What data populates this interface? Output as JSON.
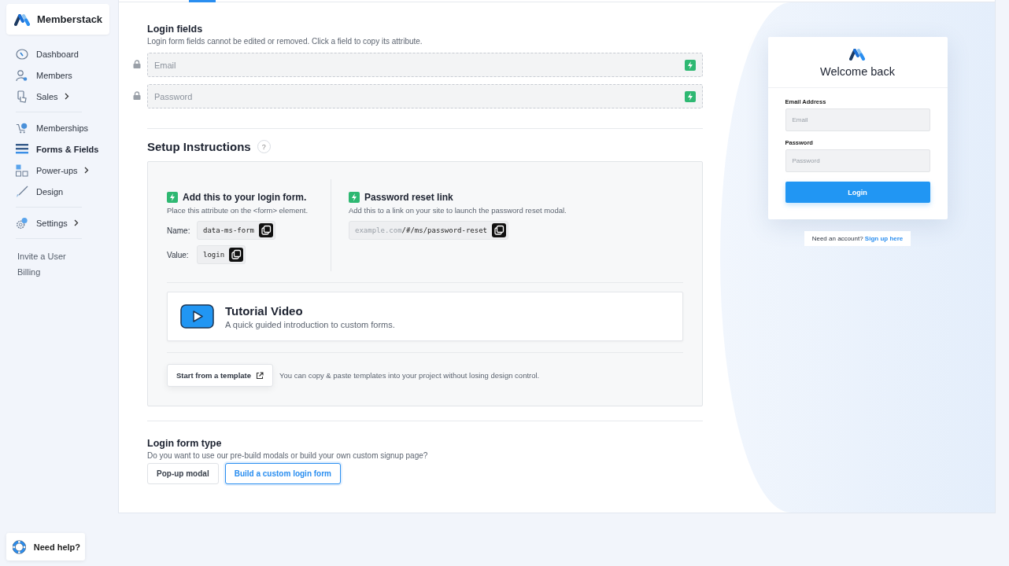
{
  "sidebar": {
    "brand": "Memberstack",
    "sections": [
      {
        "items": [
          {
            "label": "Dashboard",
            "selected": false,
            "has_submenu": false
          },
          {
            "label": "Members",
            "selected": false,
            "has_submenu": false
          },
          {
            "label": "Sales",
            "selected": false,
            "has_submenu": true
          }
        ]
      },
      {
        "items": [
          {
            "label": "Memberships",
            "selected": false,
            "has_submenu": false
          },
          {
            "label": "Forms & Fields",
            "selected": true,
            "has_submenu": false
          },
          {
            "label": "Power-ups",
            "selected": false,
            "has_submenu": true
          },
          {
            "label": "Design",
            "selected": false,
            "has_submenu": false
          }
        ]
      },
      {
        "items": [
          {
            "label": "Settings",
            "selected": false,
            "has_submenu": true
          }
        ]
      }
    ],
    "links": [
      "Invite a User",
      "Billing"
    ]
  },
  "login_fields": {
    "title": "Login fields",
    "description": "Login form fields cannot be edited or removed. Click a field to copy its attribute.",
    "fields": [
      {
        "placeholder": "Email",
        "locked": true
      },
      {
        "placeholder": "Password",
        "locked": true
      }
    ]
  },
  "setup": {
    "title": "Setup Instructions",
    "help": "?",
    "login_form": {
      "title": "Add this to your login form.",
      "description": "Place this attribute on the <form> element.",
      "name_label": "Name:",
      "name_value": "data-ms-form",
      "value_label": "Value:",
      "value_value": "login"
    },
    "reset": {
      "title": "Password reset link",
      "description": "Add this to a link on your site to launch the password reset modal.",
      "url_host": "example.com",
      "url_path": "/#/ms/password-reset"
    },
    "tutorial": {
      "title": "Tutorial Video",
      "description": "A quick guided introduction to custom forms."
    },
    "template": {
      "button": "Start from a template",
      "note": "You can copy & paste templates into your project without losing design control."
    }
  },
  "form_type": {
    "title": "Login form type",
    "description": "Do you want to use our pre-build modals or build your own custom signup page?",
    "options": [
      {
        "label": "Pop-up modal",
        "selected": false
      },
      {
        "label": "Build a custom login form",
        "selected": true
      }
    ]
  },
  "preview": {
    "title": "Welcome back",
    "fields": [
      {
        "label": "Email Address",
        "placeholder": "Email"
      },
      {
        "label": "Password",
        "placeholder": "Password"
      }
    ],
    "button": "Login",
    "signup_prompt": "Need an account?",
    "signup_link": "Sign up here"
  },
  "help": {
    "label": "Need help?"
  }
}
